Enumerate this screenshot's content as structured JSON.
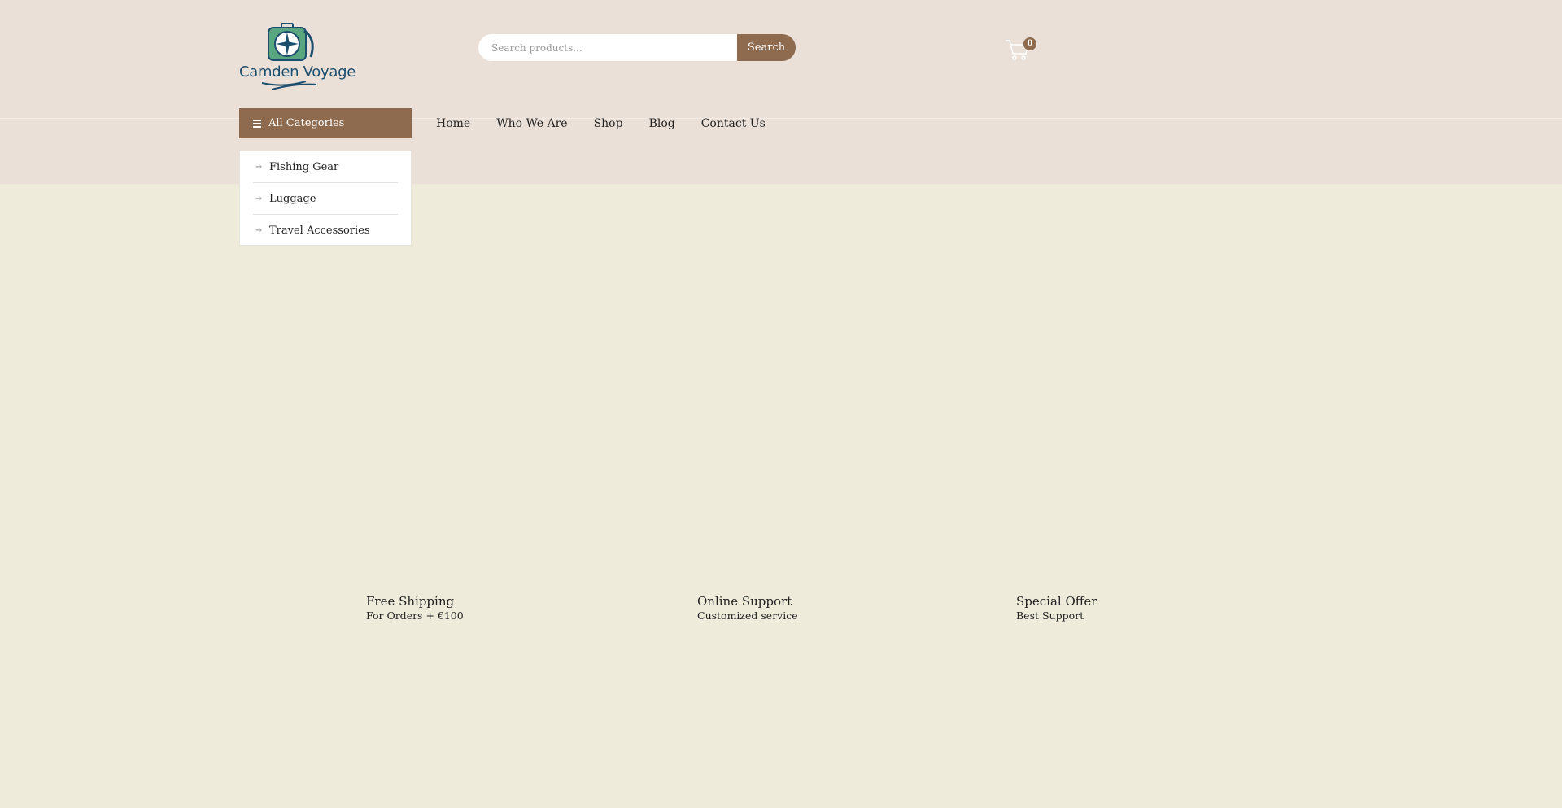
{
  "header": {
    "logo_text": "Camden Voyage",
    "search_placeholder": "Search products...",
    "search_button": "Search",
    "cart_count": "0"
  },
  "nav": {
    "all_categories": "All Categories",
    "menu": [
      "Home",
      "Who We Are",
      "Shop",
      "Blog",
      "Contact Us"
    ]
  },
  "categories": [
    "Fishing Gear",
    "Luggage",
    "Travel Accessories"
  ],
  "features": [
    {
      "title": "Free Shipping",
      "subtitle": "For Orders + €100"
    },
    {
      "title": "Online Support",
      "subtitle": "Customized service"
    },
    {
      "title": "Special Offer",
      "subtitle": "Best Support"
    }
  ],
  "colors": {
    "accent": "#8e6a4e",
    "header_bg": "#ebe0d8",
    "page_bg": "#efebdb",
    "logo": "#1c4e6e"
  }
}
